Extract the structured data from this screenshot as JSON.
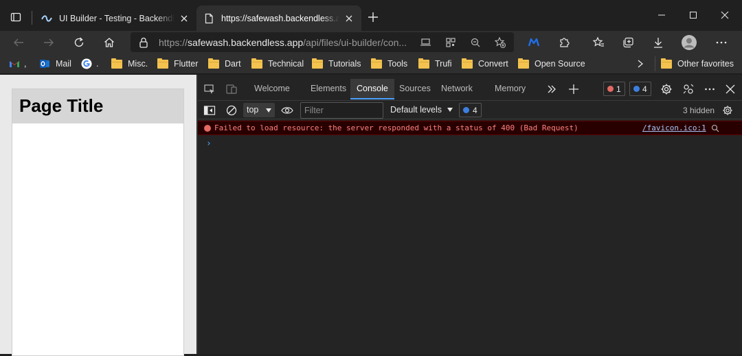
{
  "tabs": [
    {
      "title": "UI Builder - Testing - Backendless"
    },
    {
      "title": "https://safewash.backendless.app/api/files/ui-builder"
    }
  ],
  "address": {
    "scheme": "https://",
    "host": "safewash.backendless.app",
    "path": "/api/files/ui-builder/con..."
  },
  "favorites": [
    {
      "label": ","
    },
    {
      "label": "Mail"
    },
    {
      "label": "."
    },
    {
      "label": "Misc."
    },
    {
      "label": "Flutter"
    },
    {
      "label": "Dart"
    },
    {
      "label": "Technical"
    },
    {
      "label": "Tutorials"
    },
    {
      "label": "Tools"
    },
    {
      "label": "Trufi"
    },
    {
      "label": "Convert"
    },
    {
      "label": "Open Source"
    },
    {
      "label": "Other favorites"
    }
  ],
  "page": {
    "title": "Page Title"
  },
  "devtools": {
    "tabs": [
      "Welcome",
      "Elements",
      "Console",
      "Sources",
      "Network",
      "Memory"
    ],
    "error_count": "1",
    "message_count": "4",
    "context": "top",
    "filter_placeholder": "Filter",
    "levels": "Default levels",
    "level_badge": "4",
    "hidden": "3 hidden",
    "error_message": "Failed to load resource: the server responded with a status of 400 (Bad Request)",
    "error_source": "/favicon.ico:1",
    "prompt": "›"
  },
  "colors": {
    "accent": "#4aa1ff",
    "error": "#e46962",
    "info": "#3d7fe0",
    "folder": "#f3c24f"
  }
}
